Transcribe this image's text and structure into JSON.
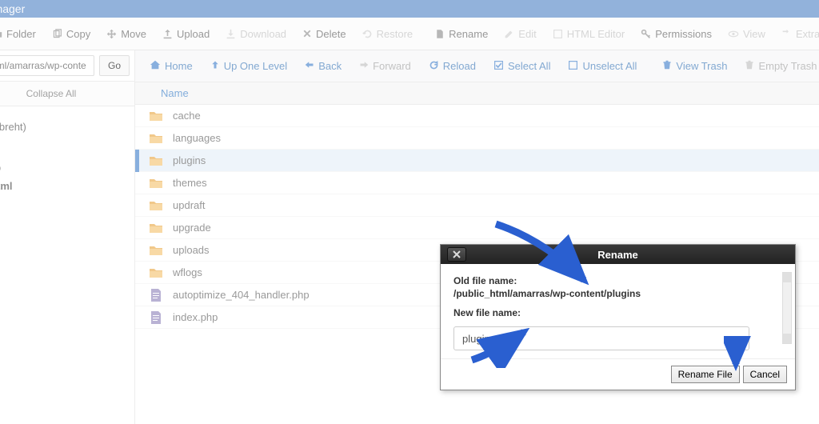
{
  "app_title": "Manager",
  "toolbar": {
    "folder": "Folder",
    "copy": "Copy",
    "move": "Move",
    "upload": "Upload",
    "download": "Download",
    "delete": "Delete",
    "restore": "Restore",
    "rename": "Rename",
    "edit": "Edit",
    "html_editor": "HTML Editor",
    "permissions": "Permissions",
    "view": "View",
    "extract": "Extra"
  },
  "path_input": "c_html/amarras/wp-conte",
  "go_label": "Go",
  "collapse_label": "Collapse All",
  "tree": {
    "item0": "me/abreht)",
    "item1": "ic_ftp",
    "item2": "ic_html"
  },
  "subbar": {
    "home": "Home",
    "up": "Up One Level",
    "back": "Back",
    "forward": "Forward",
    "reload": "Reload",
    "select_all": "Select All",
    "unselect_all": "Unselect All",
    "view_trash": "View Trash",
    "empty_trash": "Empty Trash"
  },
  "list_header": "Name",
  "files": {
    "f0": "cache",
    "f1": "languages",
    "f2": "plugins",
    "f3": "themes",
    "f4": "updraft",
    "f5": "upgrade",
    "f6": "uploads",
    "f7": "wflogs",
    "f8": "autoptimize_404_handler.php",
    "f9": "index.php"
  },
  "dialog": {
    "title": "Rename",
    "old_label": "Old file name:",
    "old_value": "/public_html/amarras/wp-content/plugins",
    "new_label": "New file name:",
    "new_value": "plugins_BK",
    "btn_rename": "Rename File",
    "btn_cancel": "Cancel"
  }
}
